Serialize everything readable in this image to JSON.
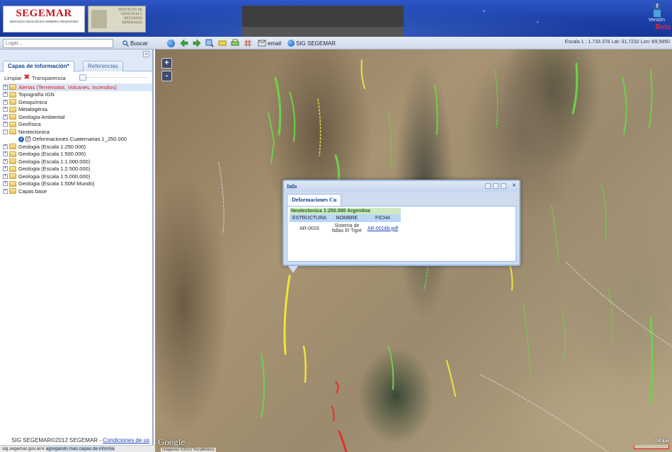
{
  "header": {
    "logo_title": "SEGEMAR",
    "logo_subtitle": "SERVICIO GEOLÓGICO MINERO ARGENTINO",
    "institute_line1": "INSTITUTO DE",
    "institute_line2": "GEOLOGIA Y",
    "institute_line3": "RECURSOS",
    "institute_line4": "MINERALES",
    "version_label": "Versión",
    "version_value": "Beta",
    "facebook_icon": "facebook-icon",
    "twitter_icon": "twitter-icon"
  },
  "toolbar": {
    "search_placeholder": "Lugar...",
    "search_button": "Buscar",
    "email_label": "email",
    "sig_label": "SIG SEGEMAR",
    "scale_readout": "Escala 1 : 1.733.376   Lat:-31,7232 Lon:-69,5850",
    "icons": [
      "globe-icon",
      "back-arrow-icon",
      "forward-arrow-icon",
      "zoom-icon",
      "measure-icon",
      "print-icon",
      "grid-icon"
    ]
  },
  "sidebar": {
    "collapse_label": "«",
    "tabs": [
      {
        "label": "Capas de información*"
      },
      {
        "label": "Referencias"
      }
    ],
    "clear_label": "Limpiar",
    "transparency_label": "Transparencia",
    "tree": [
      {
        "label": "Alertas (Terremotos, Volcanes, Incendios)",
        "alert": true
      },
      {
        "label": "Topografía IGN"
      },
      {
        "label": "Geoquímica"
      },
      {
        "label": "Metalogénia"
      },
      {
        "label": "Geología Ambiental"
      },
      {
        "label": "Geofísica"
      },
      {
        "label": "Neotectonica",
        "expanded": true
      },
      {
        "label": "Deformaciones Cuaternarias 1_250.000",
        "leaf": true,
        "checked": true
      },
      {
        "label": "Geologia (Escala 1:250.000)"
      },
      {
        "label": "Geologia (Escala 1:500.000)"
      },
      {
        "label": "Geologia (Escala 1:1.000.000)"
      },
      {
        "label": "Geologia (Escala 1:2.500.000)"
      },
      {
        "label": "Geologia (Escala 1:5.000.000)"
      },
      {
        "label": "Geologia (Escala 1:50M Mundo)"
      },
      {
        "label": "Capas base"
      }
    ],
    "footer_text": "SIG SEGEMAR©2012 SEGEMAR - ",
    "footer_link": "Condiciones de us"
  },
  "statusbar": {
    "url": "sig.segemar.gov.ar/#",
    "message": "agregando mas capas de informa"
  },
  "map": {
    "zoom_in": "+",
    "zoom_out": "-",
    "provider": "Google",
    "credit": "Imágenes ©2013 TerraMetrics",
    "scale": "50 km"
  },
  "info_popup": {
    "title": "Info",
    "tab_label": "Deformaciones Cu",
    "layer_caption": "Neotectonica 1:250.000 Argentina",
    "columns": [
      "ESTRUCTURA",
      "NOMBRE",
      "FICHA"
    ],
    "row": {
      "estructura": "AR-0016",
      "nombre_line1": "Sistema de",
      "nombre_line2": "fallas El Tigre",
      "ficha": "AR-0016b.pdf"
    }
  }
}
